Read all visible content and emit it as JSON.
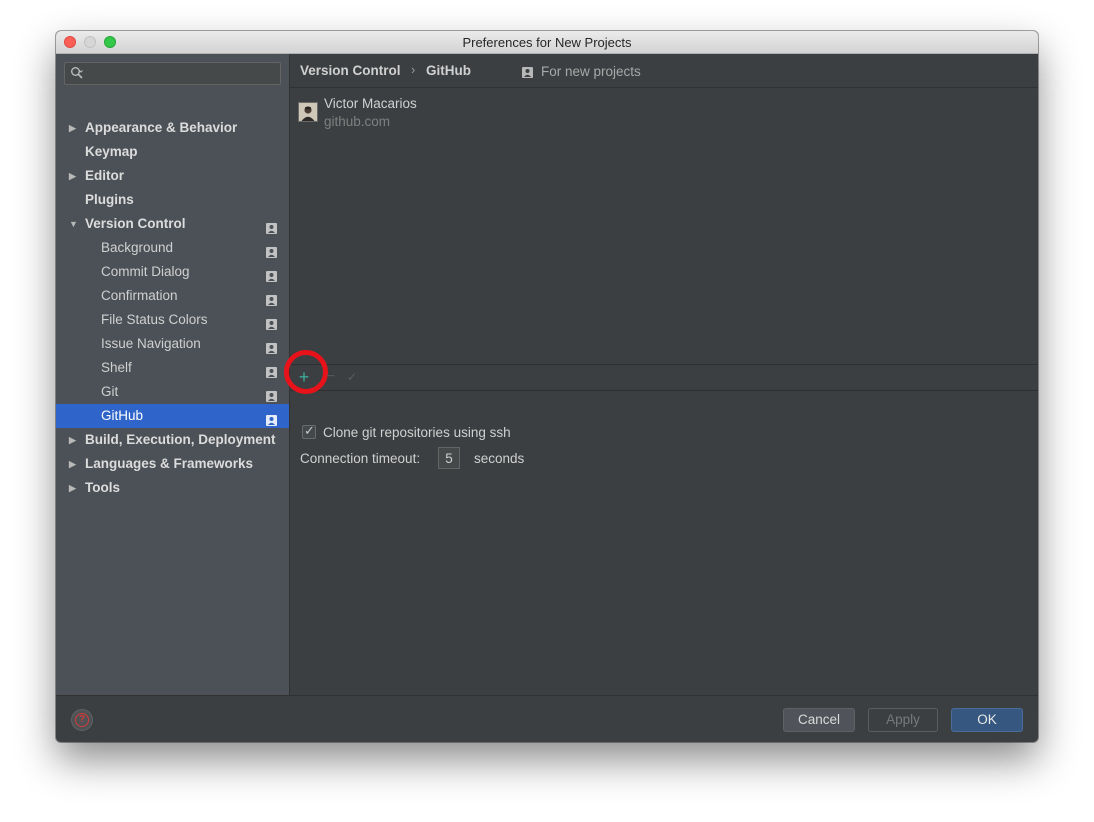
{
  "window": {
    "title": "Preferences for New Projects"
  },
  "search": {
    "placeholder": ""
  },
  "sidebar": {
    "items": [
      {
        "label": "Appearance & Behavior",
        "expandable": true
      },
      {
        "label": "Keymap"
      },
      {
        "label": "Editor",
        "expandable": true
      },
      {
        "label": "Plugins"
      },
      {
        "label": "Version Control",
        "expanded": true
      },
      {
        "label": "Background"
      },
      {
        "label": "Commit Dialog"
      },
      {
        "label": "Confirmation"
      },
      {
        "label": "File Status Colors"
      },
      {
        "label": "Issue Navigation"
      },
      {
        "label": "Shelf"
      },
      {
        "label": "Git"
      },
      {
        "label": "GitHub",
        "selected": true
      },
      {
        "label": "Build, Execution, Deployment",
        "expandable": true
      },
      {
        "label": "Languages & Frameworks",
        "expandable": true
      },
      {
        "label": "Tools",
        "expandable": true
      }
    ]
  },
  "breadcrumb": {
    "parent": "Version Control",
    "separator": "›",
    "current": "GitHub",
    "scope": "For new projects"
  },
  "accounts": [
    {
      "name": "Victor Macarios",
      "host": "github.com"
    }
  ],
  "settings": {
    "clone_ssh_label": "Clone git repositories using ssh",
    "clone_ssh_checked": true,
    "timeout_label": "Connection timeout:",
    "timeout_value": "5",
    "timeout_unit": "seconds"
  },
  "footer": {
    "cancel_label": "Cancel",
    "apply_label": "Apply",
    "ok_label": "OK"
  },
  "colors": {
    "selection": "#2f65ca",
    "add_icon": "#3da89c",
    "highlight_ring": "#e8121a",
    "ok_button": "#365880"
  }
}
